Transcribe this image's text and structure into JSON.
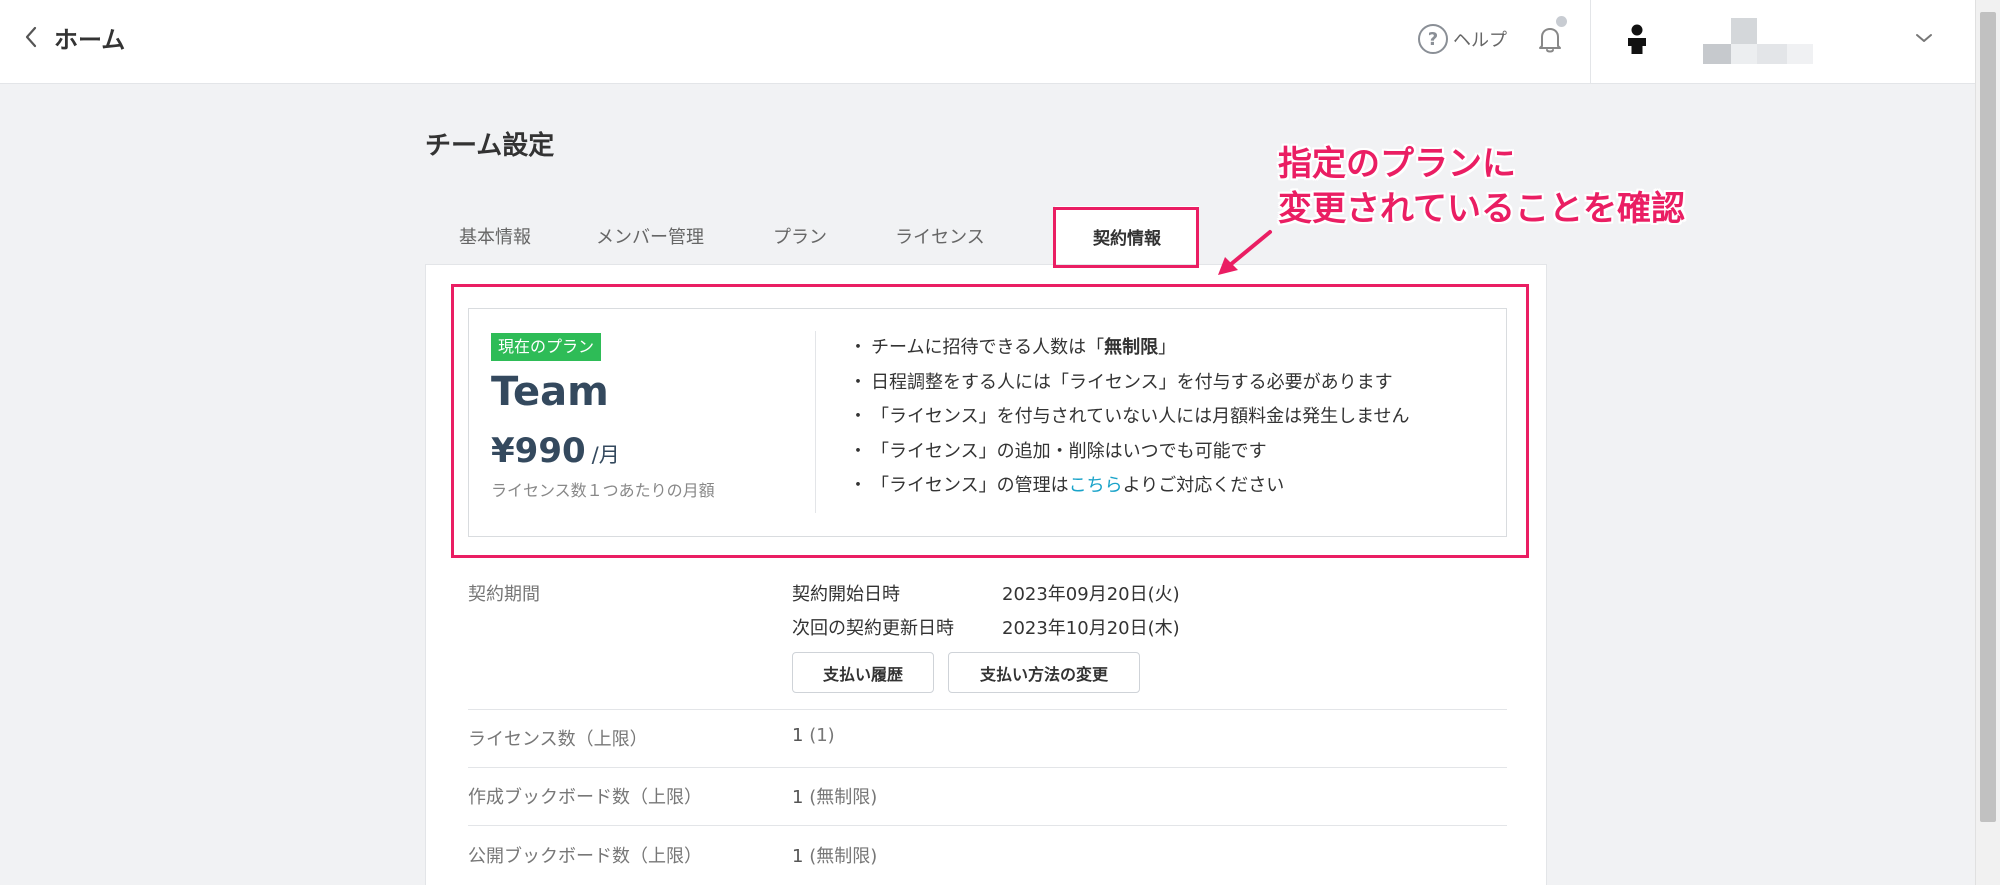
{
  "header": {
    "back_label": "ホーム",
    "help_label": "ヘルプ",
    "help_symbol": "?"
  },
  "page": {
    "title": "チーム設定"
  },
  "tabs": [
    {
      "label": "基本情報"
    },
    {
      "label": "メンバー管理"
    },
    {
      "label": "プラン"
    },
    {
      "label": "ライセンス"
    },
    {
      "label": "契約情報"
    }
  ],
  "active_tab_index": 4,
  "plan": {
    "badge": "現在のプラン",
    "name": "Team",
    "price": "¥990",
    "unit": "/月",
    "price_note": "ライセンス数１つあたりの月額",
    "features": {
      "f1_prefix": "チームに招待できる人数は「",
      "f1_bold": "無制限",
      "f1_suffix": "」",
      "f2": "日程調整をする人には「ライセンス」を付与する必要があります",
      "f3": "「ライセンス」を付与されていない人には月額料金は発生しません",
      "f4": "「ライセンス」の追加・削除はいつでも可能です",
      "f5_prefix": "「ライセンス」の管理は",
      "f5_link": "こちら",
      "f5_suffix": "よりご対応ください"
    },
    "bullet": "・"
  },
  "contract": {
    "label": "契約期間",
    "start_label": "契約開始日時",
    "start_value": "2023年09月20日(火)",
    "renew_label": "次回の契約更新日時",
    "renew_value": "2023年10月20日(木)",
    "payment_history_button": "支払い履歴",
    "payment_method_button": "支払い方法の変更"
  },
  "stats": [
    {
      "label": "ライセンス数（上限）",
      "value": "1",
      "paren": "(1)"
    },
    {
      "label": "作成ブックボード数（上限）",
      "value": "1",
      "paren": "(無制限)"
    },
    {
      "label": "公開ブックボード数（上限）",
      "value": "1",
      "paren": "(無制限)"
    }
  ],
  "annotation": {
    "line1": "指定のプランに",
    "line2": "変更されていることを確認"
  },
  "colors": {
    "accent_pink": "#ea1e63",
    "badge_green": "#2ebc57",
    "link_blue": "#1aa3c9"
  },
  "icons": {
    "back": "chevron-left-icon",
    "help": "help-circle-icon",
    "bell": "bell-icon",
    "avatar": "user-avatar-icon",
    "dropdown": "chevron-down-icon"
  }
}
